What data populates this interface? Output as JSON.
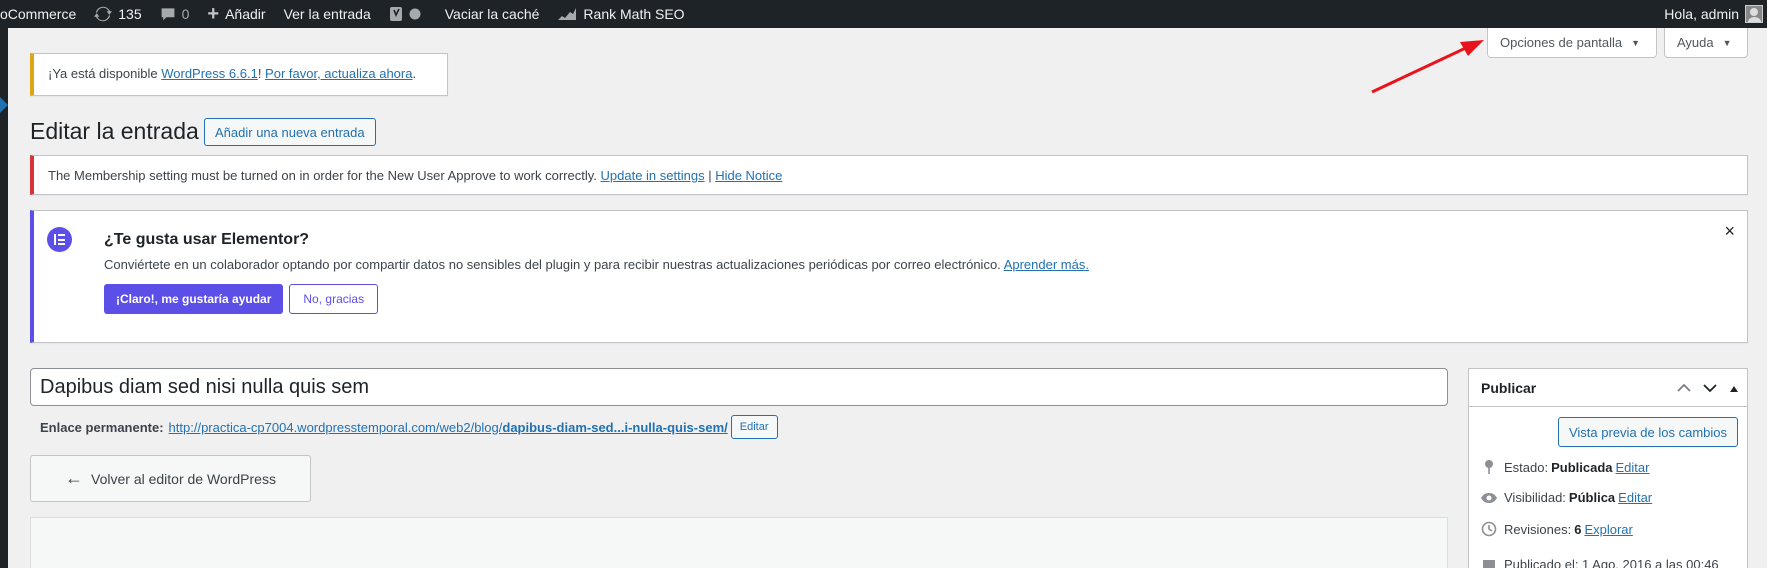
{
  "adminbar": {
    "woocommerce": "oCommerce",
    "updates_count": "135",
    "comments_count": "0",
    "add_new": "Añadir",
    "view_post": "Ver la entrada",
    "clear_cache": "Vaciar la caché",
    "rank_math": "Rank Math SEO",
    "greeting": "Hola, admin"
  },
  "screen_meta": {
    "screen_options": "Opciones de pantalla",
    "help": "Ayuda"
  },
  "update_nag": {
    "prefix": "¡Ya está disponible ",
    "link1": "WordPress 6.6.1",
    "mid": "! ",
    "link2": "Por favor, actualiza ahora",
    "suffix": "."
  },
  "page": {
    "title": "Editar la entrada",
    "add_new": "Añadir una nueva entrada"
  },
  "membership_notice": {
    "text": "The Membership setting must be turned on in order for the New User Approve to work correctly. ",
    "link1": "Update in settings",
    "sep": " | ",
    "link2": "Hide Notice"
  },
  "elementor_notice": {
    "title": "¿Te gusta usar Elementor?",
    "text": "Conviértete en un colaborador optando por compartir datos no sensibles del plugin y para recibir nuestras actualizaciones periódicas por correo electrónico. ",
    "link": "Aprender más.",
    "accept": "¡Claro!, me gustaría ayudar",
    "decline": "No, gracias",
    "close": "×"
  },
  "post": {
    "title": "Dapibus diam sed nisi nulla quis sem",
    "permalink_label": "Enlace permanente:",
    "permalink_base": "http://practica-cp7004.wordpresstemporal.com/web2/blog/",
    "permalink_slug": "dapibus-diam-sed...i-nulla-quis-sem/",
    "permalink_edit": "Editar",
    "back_to_editor": "Volver al editor de WordPress"
  },
  "publish": {
    "title": "Publicar",
    "preview": "Vista previa de los cambios",
    "status_label": "Estado:",
    "status_value": "Publicada",
    "status_edit": "Editar",
    "visibility_label": "Visibilidad:",
    "visibility_value": "Pública",
    "visibility_edit": "Editar",
    "revisions_label": "Revisiones:",
    "revisions_value": "6",
    "revisions_link": "Explorar",
    "published_text": "Publicado el: 1 Ago, 2016 a las 00:46"
  },
  "colors": {
    "adminbar": "#1d2327",
    "wp_blue": "#2271b1",
    "elementor": "#5b4fe8",
    "warning": "#dba617",
    "error": "#d63638",
    "annotation_arrow": "#e8141b"
  }
}
